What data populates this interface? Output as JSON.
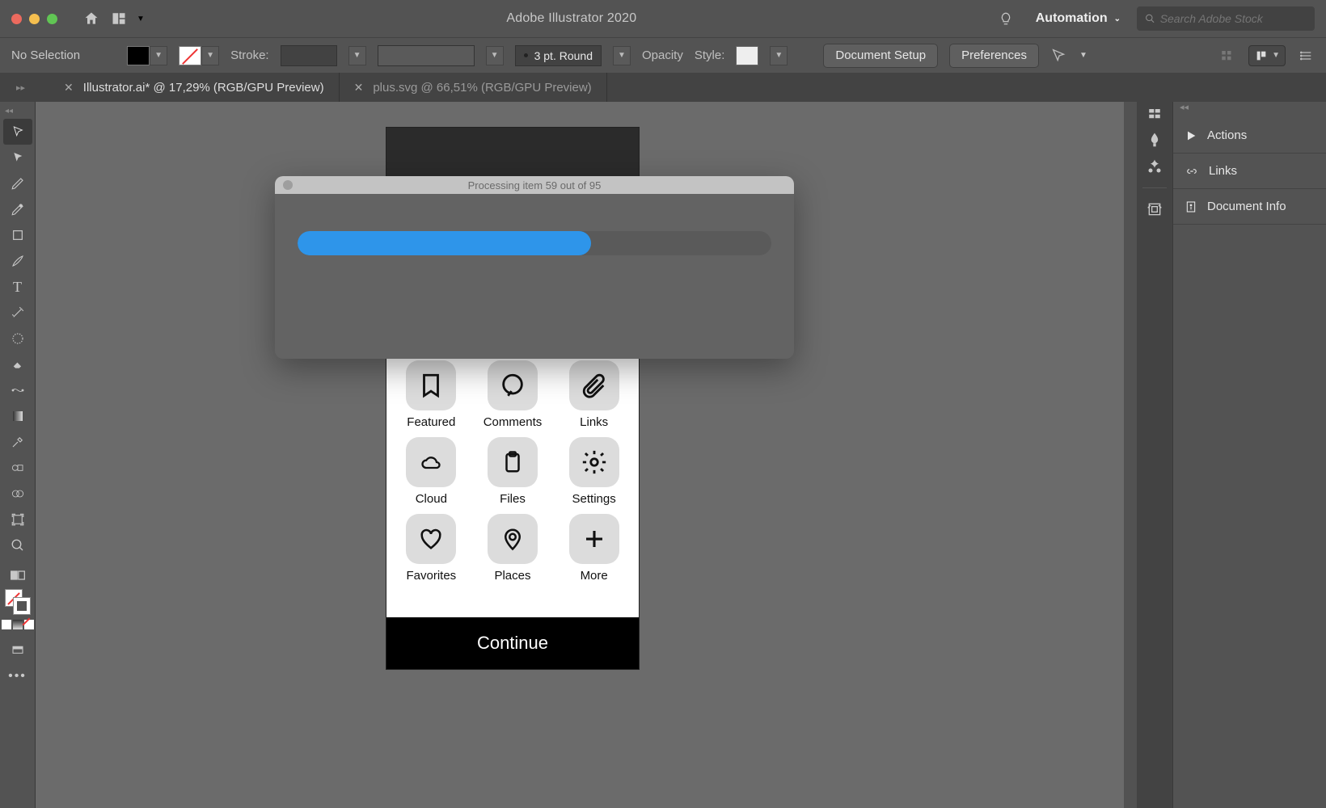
{
  "menubar": {
    "app_title": "Adobe Illustrator 2020",
    "workspace_label": "Automation",
    "search_placeholder": "Search Adobe Stock"
  },
  "controlbar": {
    "selection_label": "No Selection",
    "stroke_label": "Stroke:",
    "brush_label": "3 pt. Round",
    "opacity_label": "Opacity",
    "style_label": "Style:",
    "doc_setup_label": "Document Setup",
    "prefs_label": "Preferences"
  },
  "tabs": [
    {
      "label": "Illustrator.ai* @ 17,29% (RGB/GPU Preview)",
      "active": true
    },
    {
      "label": "plus.svg @ 66,51% (RGB/GPU Preview)",
      "active": false
    }
  ],
  "panels": [
    {
      "label": "Actions",
      "icon": "play"
    },
    {
      "label": "Links",
      "icon": "link"
    },
    {
      "label": "Document Info",
      "icon": "docinfo"
    }
  ],
  "artboard": {
    "tiles": [
      {
        "label": "Featured",
        "icon": "bookmark"
      },
      {
        "label": "Comments",
        "icon": "comment"
      },
      {
        "label": "Links",
        "icon": "clip"
      },
      {
        "label": "Cloud",
        "icon": "cloud"
      },
      {
        "label": "Files",
        "icon": "clipboard"
      },
      {
        "label": "Settings",
        "icon": "gear"
      },
      {
        "label": "Favorites",
        "icon": "heart"
      },
      {
        "label": "Places",
        "icon": "pin"
      },
      {
        "label": "More",
        "icon": "plus"
      }
    ],
    "continue_label": "Continue"
  },
  "dialog": {
    "title": "Processing item 59 out of 95",
    "current": 59,
    "total": 95,
    "progress_pct": 62
  }
}
